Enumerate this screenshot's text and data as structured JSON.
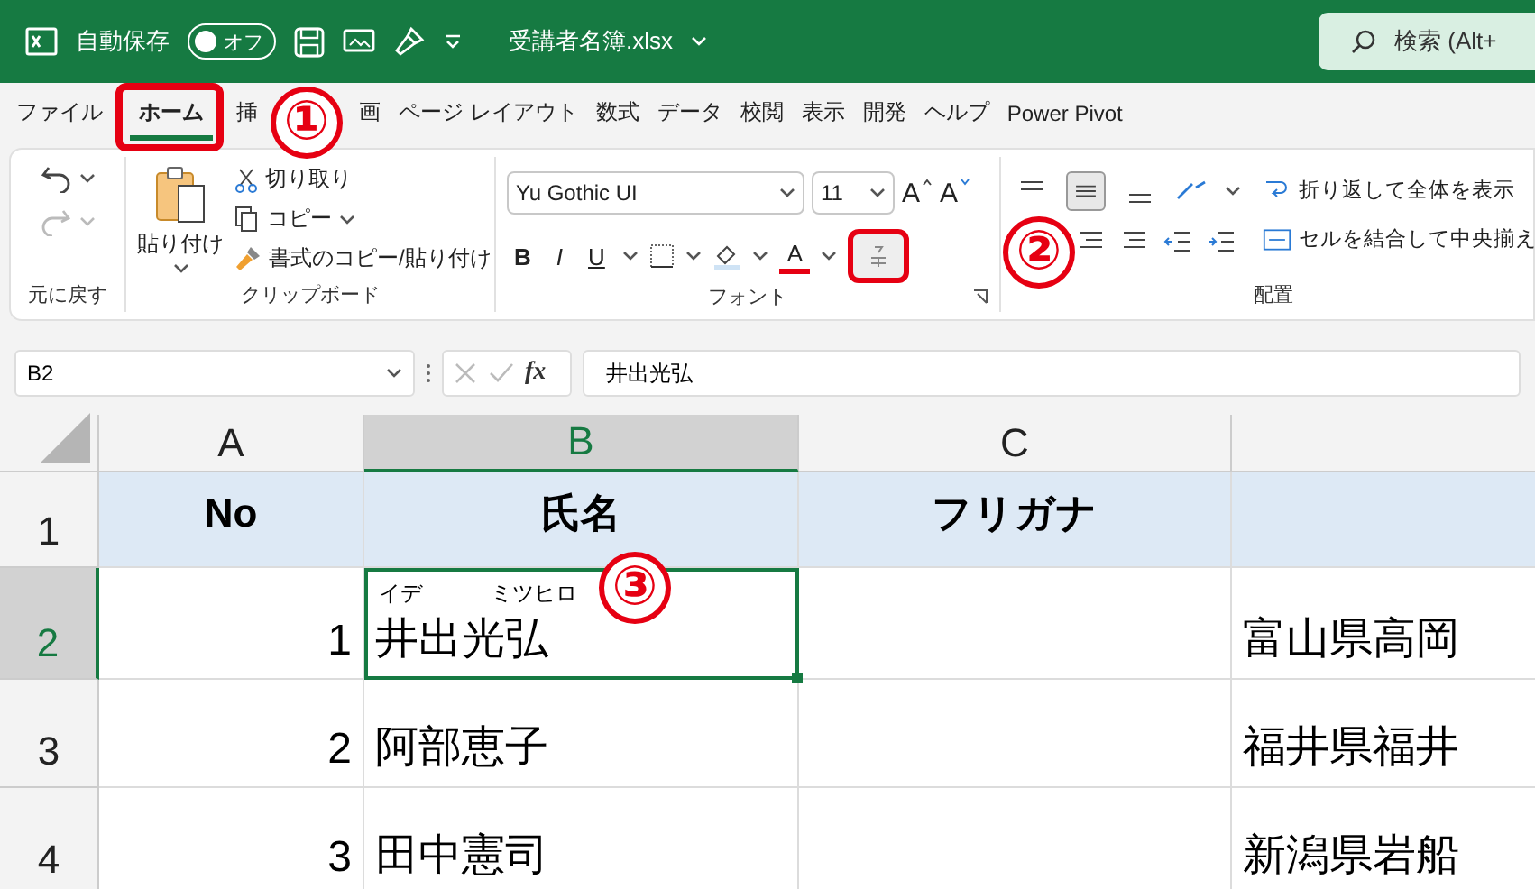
{
  "title_bar": {
    "autosave_label": "自動保存",
    "autosave": {
      "on": false,
      "label": "オフ"
    },
    "filename": "受講者名簿.xlsx",
    "search": {
      "placeholder": "検索 (Alt+"
    }
  },
  "tabs": [
    {
      "label": "ファイル",
      "selected": false
    },
    {
      "label": "ホーム",
      "selected": true
    },
    {
      "label": "挿",
      "selected": false
    },
    {
      "label": "画",
      "selected": false
    },
    {
      "label": "ページ レイアウト",
      "selected": false
    },
    {
      "label": "数式",
      "selected": false
    },
    {
      "label": "データ",
      "selected": false
    },
    {
      "label": "校閲",
      "selected": false
    },
    {
      "label": "表示",
      "selected": false
    },
    {
      "label": "開発",
      "selected": false
    },
    {
      "label": "ヘルプ",
      "selected": false
    },
    {
      "label": "Power Pivot",
      "selected": false
    }
  ],
  "ribbon": {
    "undo": {
      "label": "元に戻す"
    },
    "clipboard": {
      "paste": "貼り付け",
      "cut": "切り取り",
      "copy": "コピー",
      "format_painter": "書式のコピー/貼り付け",
      "label": "クリップボード"
    },
    "font": {
      "name": "Yu Gothic UI",
      "size": "11",
      "bold": "B",
      "italic": "I",
      "underline": "U",
      "grow": "A",
      "shrink": "A",
      "font_color": "A",
      "label": "フォント"
    },
    "alignment": {
      "wrap": "折り返して全体を表示",
      "merge": "セルを結合して中央揃え",
      "label": "配置"
    }
  },
  "formula_bar": {
    "name_box": "B2",
    "fx": "fx",
    "value": "井出光弘"
  },
  "columns": [
    {
      "label": "A",
      "selected": false
    },
    {
      "label": "B",
      "selected": true
    },
    {
      "label": "C",
      "selected": false
    },
    {
      "selected": false
    }
  ],
  "rows": [
    {
      "number": "1",
      "selected": false,
      "header": true,
      "cells": [
        {
          "text": "No",
          "selected": false
        },
        {
          "text": "氏名",
          "selected": false
        },
        {
          "text": "フリガナ",
          "selected": false
        },
        {
          "selected": false
        }
      ]
    },
    {
      "number": "2",
      "selected": true,
      "header": false,
      "cells": [
        {
          "text": "1",
          "selected": false
        },
        {
          "text": "井出光弘",
          "furigana": [
            "イデ",
            "ミツヒロ"
          ],
          "selected": true
        },
        {
          "selected": false
        },
        {
          "text": "富山県高岡",
          "selected": false
        }
      ]
    },
    {
      "number": "3",
      "selected": false,
      "header": false,
      "cells": [
        {
          "text": "2",
          "selected": false
        },
        {
          "text": "阿部恵子",
          "selected": false
        },
        {
          "selected": false
        },
        {
          "text": "福井県福井",
          "selected": false
        }
      ]
    },
    {
      "number": "4",
      "selected": false,
      "header": false,
      "cells": [
        {
          "text": "3",
          "selected": false
        },
        {
          "text": "田中憲司",
          "selected": false
        },
        {
          "selected": false
        },
        {
          "text": "新潟県岩船",
          "selected": false
        }
      ]
    }
  ],
  "annotations": [
    {
      "kind": "circle",
      "label": "①"
    },
    {
      "kind": "circle",
      "label": "②"
    },
    {
      "kind": "circle",
      "label": "③"
    }
  ]
}
